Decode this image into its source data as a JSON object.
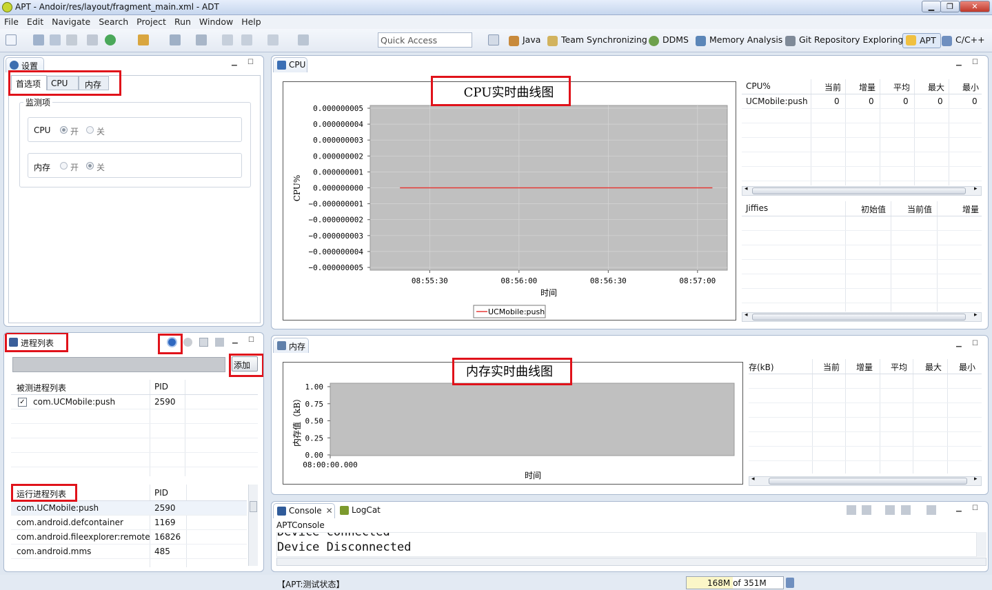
{
  "window": {
    "title": "APT - Andoir/res/layout/fragment_main.xml - ADT",
    "min": "▁",
    "max": "❐",
    "close": "✕"
  },
  "menu": [
    "File",
    "Edit",
    "Navigate",
    "Search",
    "Project",
    "Run",
    "Window",
    "Help"
  ],
  "quick_access": {
    "placeholder": "Quick Access"
  },
  "perspectives": [
    {
      "label": "Java",
      "icon": "java-perspective-icon"
    },
    {
      "label": "Team Synchronizing",
      "icon": "team-sync-icon"
    },
    {
      "label": "DDMS",
      "icon": "ddms-icon"
    },
    {
      "label": "Memory Analysis",
      "icon": "memory-analysis-icon"
    },
    {
      "label": "Git Repository Exploring",
      "icon": "git-icon"
    },
    {
      "label": "APT",
      "icon": "apt-icon"
    },
    {
      "label": "C/C++",
      "icon": "cpp-icon"
    }
  ],
  "settings": {
    "title": "设置",
    "tabs": [
      "首选项",
      "CPU",
      "内存"
    ],
    "group": "监测项",
    "cpu": {
      "label": "CPU",
      "on": "开",
      "off": "关",
      "selected": "on"
    },
    "mem": {
      "label": "内存",
      "on": "开",
      "off": "关",
      "selected": "off"
    }
  },
  "process": {
    "title": "进程列表",
    "add": "添加",
    "monitored": {
      "col1": "被测进程列表",
      "col2": "PID",
      "rows": [
        {
          "name": "com.UCMobile:push",
          "pid": "2590",
          "checked": true
        }
      ]
    },
    "running": {
      "col1": "运行进程列表",
      "col2": "PID",
      "rows": [
        {
          "name": "com.UCMobile:push",
          "pid": "2590"
        },
        {
          "name": "com.android.defcontainer",
          "pid": "1169"
        },
        {
          "name": "com.android.fileexplorer:remote",
          "pid": "16826"
        },
        {
          "name": "com.android.mms",
          "pid": "485"
        }
      ]
    }
  },
  "cpu_view": {
    "tab": "CPU",
    "table1": {
      "cols": [
        "CPU%",
        "当前",
        "增量",
        "平均",
        "最大",
        "最小"
      ],
      "rows": [
        [
          "UCMobile:push",
          "0",
          "0",
          "0",
          "0",
          "0"
        ]
      ]
    },
    "table2": {
      "cols": [
        "Jiffies",
        "初始值",
        "当前值",
        "增量"
      ]
    }
  },
  "mem_view": {
    "tab": "内存",
    "table": {
      "cols": [
        "存(kB)",
        "当前",
        "增量",
        "平均",
        "最大",
        "最小"
      ]
    }
  },
  "console": {
    "tabs": [
      "Console",
      "LogCat"
    ],
    "name": "APTConsole",
    "lines": [
      "Device connected",
      "Device Disconnected"
    ]
  },
  "status": {
    "text": "【APT:测试状态】",
    "heap": "168M of 351M",
    "heap_used_fraction": 0.48
  },
  "chart_data": [
    {
      "type": "line",
      "title": "CPU实时曲线图",
      "xlabel": "时间",
      "ylabel": "CPU%",
      "x_ticks": [
        "08:55:30",
        "08:56:00",
        "08:56:30",
        "08:57:00"
      ],
      "y_ticks": [
        "0.000000005",
        "0.000000004",
        "0.000000003",
        "0.000000002",
        "0.000000001",
        "0.000000000",
        "−0.000000001",
        "−0.000000002",
        "−0.000000003",
        "−0.000000004",
        "−0.000000005"
      ],
      "ylim": [
        -5e-09,
        5e-09
      ],
      "series": [
        {
          "name": "UCMobile:push",
          "color": "#e53935",
          "x": [
            "08:55:20",
            "08:57:05"
          ],
          "y": [
            0,
            0
          ]
        }
      ],
      "legend": "bottom",
      "grid": true
    },
    {
      "type": "line",
      "title": "内存实时曲线图",
      "xlabel": "时间",
      "ylabel": "内存值（kB）",
      "x_ticks": [
        "08:00:00.000"
      ],
      "y_ticks": [
        "1.00",
        "0.75",
        "0.50",
        "0.25",
        "0.00"
      ],
      "ylim": [
        0,
        1
      ],
      "series": [],
      "grid": false
    }
  ]
}
